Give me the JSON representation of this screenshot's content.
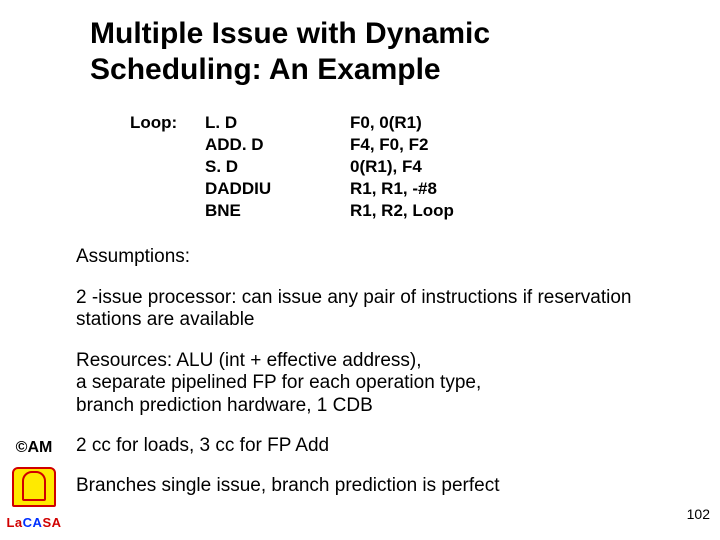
{
  "title_line1": "Multiple Issue with Dynamic",
  "title_line2": "Scheduling: An Example",
  "code": {
    "label": "Loop:",
    "rows": [
      {
        "op": "L. D",
        "args": "F0,  0(R1)"
      },
      {
        "op": "ADD. D",
        "args": "F4, F0, F2"
      },
      {
        "op": "S. D",
        "args": "0(R1),  F4"
      },
      {
        "op": "DADDIU",
        "args": "R1, R1, -#8"
      },
      {
        "op": "BNE",
        "args": "R1, R2, Loop"
      }
    ]
  },
  "paragraphs": {
    "p1": "Assumptions:",
    "p2": "2 -issue processor: can issue any pair of instructions if reservation stations are available",
    "p3": "Resources: ALU (int + effective address),",
    "p3b": "a separate pipelined FP for each operation type,",
    "p3c": "branch prediction hardware, 1 CDB",
    "p4": "2 cc for loads, 3 cc for FP Add",
    "p5": "Branches single issue, branch prediction is perfect"
  },
  "gutter": {
    "am": "©AM",
    "lacasa": {
      "la": "La",
      "ca": "CA",
      "sa": "SA"
    }
  },
  "page_number": "102"
}
